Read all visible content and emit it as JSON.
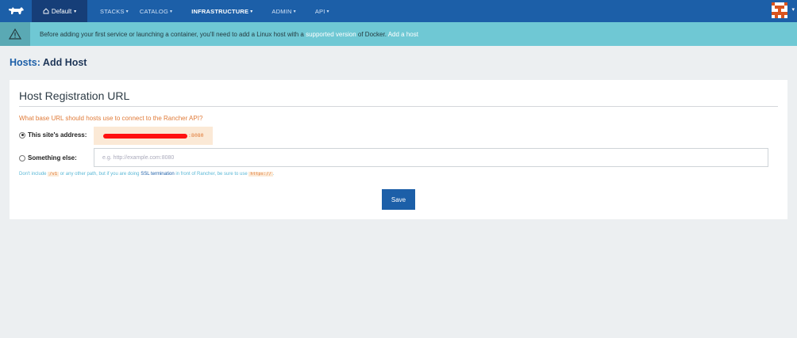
{
  "nav": {
    "env_label": "Default",
    "items": [
      {
        "label": "STACKS"
      },
      {
        "label": "CATALOG"
      },
      {
        "label": "INFRASTRUCTURE"
      },
      {
        "label": "ADMIN"
      },
      {
        "label": "API"
      }
    ]
  },
  "alert": {
    "text_before": "Before adding your first service or launching a container, you'll need to add a Linux host with a",
    "link1": "supported version",
    "text_middle": "of Docker.",
    "link2": "Add a host"
  },
  "page": {
    "crumb": "Hosts:",
    "title": "Add Host"
  },
  "card": {
    "title": "Host Registration URL",
    "question": "What base URL should hosts use to connect to the Rancher API?",
    "option1_label": "This site's address:",
    "option1_port": ":8080",
    "option2_label": "Something else:",
    "input_placeholder": "e.g. http://example.com:8080",
    "help_text1": "Don't include",
    "help_code1": "/v1",
    "help_text2": "or any other path, but if you are doing",
    "help_link": "SSL termination",
    "help_text3": "in front of Rancher, be sure to use",
    "help_code2": "https://",
    "help_text4": ".",
    "save_label": "Save"
  },
  "colors": {
    "nav_bg": "#1c5fa8",
    "alert_bg": "#6fc8d4",
    "accent_orange": "#e07b39"
  }
}
